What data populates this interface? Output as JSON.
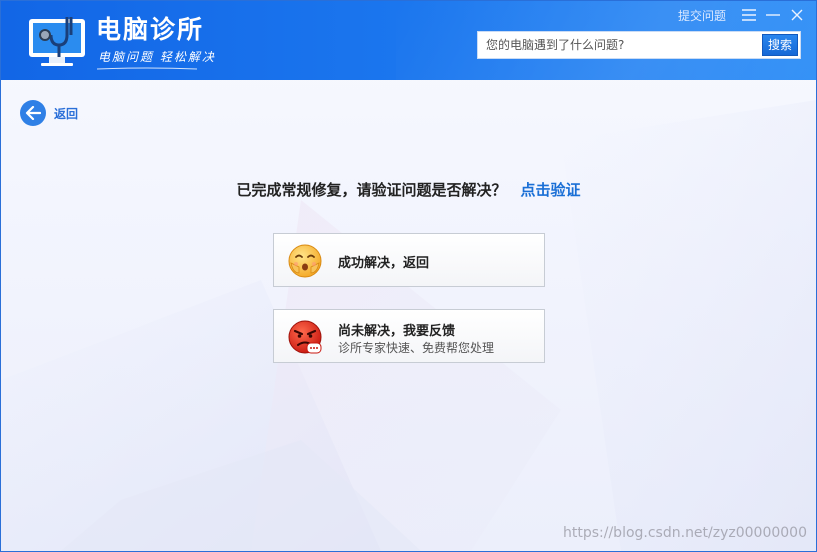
{
  "app": {
    "title": "电脑诊所",
    "slogan": "电脑问题 轻松解决"
  },
  "topbar": {
    "submit_label": "提交问题"
  },
  "search": {
    "placeholder": "您的电脑遇到了什么问题?",
    "value": "",
    "button_label": "搜索"
  },
  "back": {
    "label": "返回"
  },
  "question": {
    "text": "已完成常规修复，请验证问题是否解决？",
    "verify_link": "点击验证"
  },
  "options": [
    {
      "title": "成功解决，返回",
      "subtitle": "",
      "icon": "happy-face-icon"
    },
    {
      "title": "尚未解决，我要反馈",
      "subtitle": "诊所专家快速、免费帮您处理",
      "icon": "angry-face-icon"
    }
  ],
  "watermark": "https://blog.csdn.net/zyz00000000",
  "colors": {
    "header_blue": "#1266e6",
    "accent_blue": "#1a6fd6",
    "back_circle": "#2f80e6"
  }
}
